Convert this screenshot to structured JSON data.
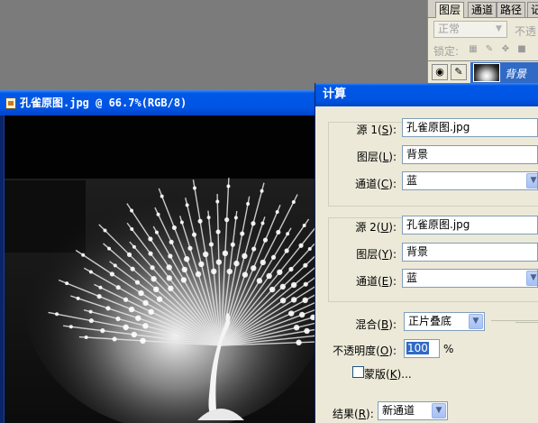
{
  "layers_panel": {
    "tabs": [
      "图层",
      "通道",
      "路径",
      "记"
    ],
    "blend_mode": "正常",
    "opacity_label": "不透",
    "lock_label": "锁定:",
    "layer_name": "背景",
    "icons": [
      "eye-icon",
      "brush-icon",
      "transparency-lock-icon",
      "pixel-lock-icon",
      "move-lock-icon",
      "all-lock-icon"
    ]
  },
  "document": {
    "title": "孔雀原图.jpg @ 66.7%(RGB/8)"
  },
  "dialog": {
    "title": "计算",
    "source1": {
      "label": "源 1",
      "key": "S",
      "value": "孔雀原图.jpg",
      "layer_label": "图层",
      "layer_key": "L",
      "layer_value": "背景",
      "channel_label": "通道",
      "channel_key": "C",
      "channel_value": "蓝"
    },
    "source2": {
      "label": "源 2",
      "key": "U",
      "value": "孔雀原图.jpg",
      "layer_label": "图层",
      "layer_key": "Y",
      "layer_value": "背景",
      "channel_label": "通道",
      "channel_key": "E",
      "channel_value": "蓝"
    },
    "blending": {
      "label": "混合",
      "key": "B",
      "value": "正片叠底"
    },
    "opacity": {
      "label": "不透明度",
      "key": "O",
      "value": "100",
      "unit": "%"
    },
    "mask": {
      "label": "蒙版",
      "key": "K",
      "suffix": "...",
      "checked": false
    },
    "result": {
      "label": "结果",
      "key": "R",
      "value": "新通道"
    }
  },
  "colors": {
    "xp_title_blue": "#0054e3",
    "dialog_bg": "#ece9d8",
    "selection_blue": "#316ac5",
    "workspace_gray": "#7b7b7b"
  }
}
